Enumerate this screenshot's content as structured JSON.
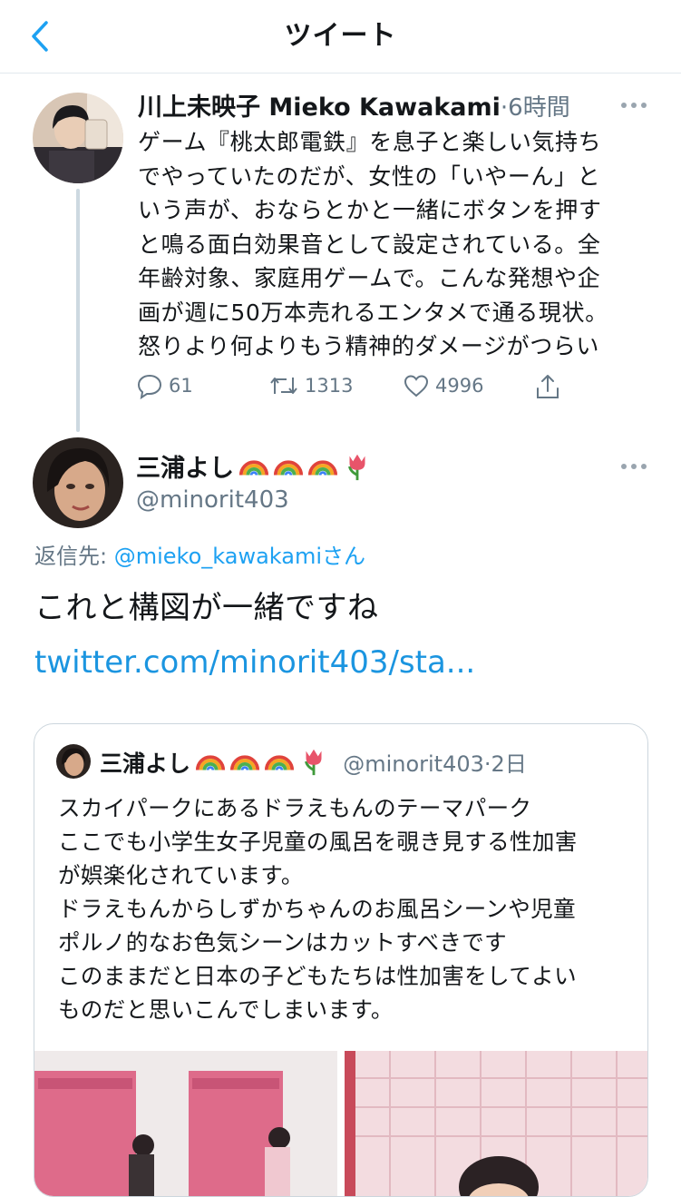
{
  "header": {
    "title": "ツイート",
    "back_icon": "chevron-left-icon"
  },
  "original_tweet": {
    "author_name": "川上未映子 Mieko Kawakami",
    "separator": "·",
    "time": "6時間",
    "body_lines": [
      "ゲーム『桃太郎電鉄』を息子と楽しい気持ち",
      "でやっていたのだが、女性の「いやーん」と",
      "いう声が、おならとかと一緒にボタンを押す",
      "と鳴る面白効果音として設定されている。全",
      "年齢対象、家庭用ゲームで。こんな発想や企",
      "画が週に50万本売れるエンタメで通る現状。",
      "怒りより何よりもう精神的ダメージがつらい"
    ],
    "actions": {
      "replies": "61",
      "retweets": "1313",
      "likes": "4996"
    }
  },
  "reply_tweet": {
    "author_name": "三浦よし",
    "author_emojis": [
      "rainbow",
      "rainbow",
      "rainbow",
      "tulip"
    ],
    "handle": "@minorit403",
    "reply_to_prefix": "返信先: ",
    "reply_to_handle": "@mieko_kawakami",
    "reply_to_suffix": "さん",
    "text": "これと構図が一緒ですね",
    "link": "twitter.com/minorit403/sta..."
  },
  "quoted_tweet": {
    "author_name": "三浦よし",
    "handle": "@minorit403",
    "separator": "·",
    "time": "2日",
    "body_lines": [
      "スカイパークにあるドラえもんのテーマパーク",
      "ここでも小学生女子児童の風呂を覗き見する性加害",
      "が娯楽化されています。",
      "ドラえもんからしずかちゃんのお風呂シーンや児童",
      "ポルノ的なお色気シーンはカットすべきです",
      "このままだと日本の子どもたちは性加害をしてよい",
      "ものだと思いこんでしまいます。"
    ]
  },
  "colors": {
    "accent": "#1da1f2",
    "link": "#1b95e0",
    "muted": "#657786",
    "border": "#e1e8ed"
  }
}
